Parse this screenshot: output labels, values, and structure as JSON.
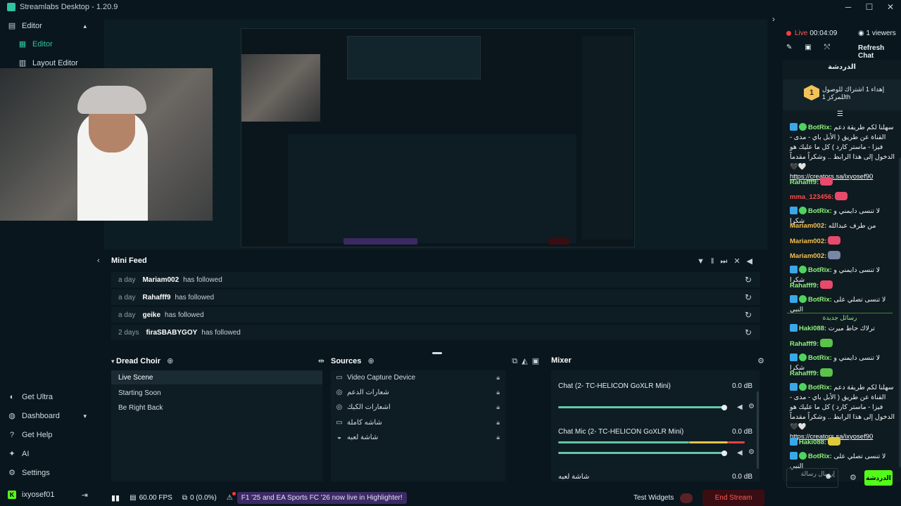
{
  "window": {
    "title": "Streamlabs Desktop - 1.20.9"
  },
  "nav": {
    "editor_group": "Editor",
    "editor": "Editor",
    "layout_editor": "Layout Editor",
    "get_ultra": "Get Ultra",
    "dashboard": "Dashboard",
    "get_help": "Get Help",
    "ai": "AI",
    "settings": "Settings",
    "username": "ixyosef01"
  },
  "mini_feed": {
    "title": "Mini Feed",
    "items": [
      {
        "time": "a day",
        "user": "Mariam002",
        "action": "has followed"
      },
      {
        "time": "a day",
        "user": "Rahafff9",
        "action": "has followed"
      },
      {
        "time": "a day",
        "user": "geike",
        "action": "has followed"
      },
      {
        "time": "2 days",
        "user": "firaSBABYGOY",
        "action": "has followed"
      }
    ]
  },
  "scenes": {
    "title": "Dread Choir",
    "items": [
      "Live Scene",
      "Starting Soon",
      "Be Right Back"
    ],
    "active": "Live Scene"
  },
  "sources": {
    "title": "Sources",
    "items": [
      {
        "icon": "camera-icon",
        "label": "Video Capture Device"
      },
      {
        "icon": "globe-icon",
        "label": "شعارات الدعم"
      },
      {
        "icon": "globe-icon",
        "label": "اشعارات الكبك"
      },
      {
        "icon": "monitor-icon",
        "label": "شاشه كاملة"
      },
      {
        "icon": "gamepad-icon",
        "label": "شاشة لعبه"
      }
    ]
  },
  "mixer": {
    "title": "Mixer",
    "channels": [
      {
        "name": "Chat (2- TC-HELICON GoXLR Mini)",
        "db": "0.0 dB",
        "level": 0.96
      },
      {
        "name": "Chat Mic (2- TC-HELICON GoXLR Mini)",
        "db": "0.0 dB",
        "level": 0.96
      },
      {
        "name": "شاشة لعبه",
        "db": "0.0 dB",
        "level": 0.96
      }
    ]
  },
  "status": {
    "fps": "60.00 FPS",
    "dropped": "0 (0.0%)",
    "notification": "F1 '25 and EA Sports FC '26 now live in Highlighter!",
    "test_widgets": "Test Widgets",
    "end_stream": "End Stream"
  },
  "chat_panel": {
    "live_label": "Live",
    "live_time": "00:04:09",
    "viewers": "1 viewers",
    "refresh": "Refresh Chat",
    "title": "الدردشة",
    "sub_goal_count": "1",
    "sub_goal_text": "إهداء 1 اشتراك للوصول",
    "sub_goal_text2": "للمركز 1th",
    "input_placeholder": "إرسال رسالة",
    "send_label": "الدردشة",
    "new_messages_divider": "رسائل جديدة",
    "messages": [
      {
        "user": "BotRix",
        "color": "green",
        "badges": [
          "blue",
          "green"
        ],
        "text": "سهلنا لكم طريقة دعم القناة عن طريق ( الأبل باي - مدى - فيزا - ماستر كارد ) كل ما عليك هو الدخول إلى هذا الرابط .. وشكراً مقدماً 🖤🤍",
        "link": "https://creators.sa/ixyosef90"
      },
      {
        "user": "Rahafff9",
        "color": "green",
        "badges": [],
        "text": "",
        "emote": "#e84a6b"
      },
      {
        "user": "mma_123456",
        "color": "red",
        "badges": [],
        "text": "",
        "emote": "#e84a6b"
      },
      {
        "user": "BotRix",
        "color": "green",
        "badges": [
          "blue",
          "green"
        ],
        "text": "لا تنسى دايمني و شكرا"
      },
      {
        "user": "Mariam002",
        "color": "yellow",
        "badges": [],
        "text": "من طرف عبدالله"
      },
      {
        "user": "Mariam002",
        "color": "yellow",
        "badges": [],
        "text": "",
        "emote": "#e84a6b"
      },
      {
        "user": "Mariam002",
        "color": "yellow",
        "badges": [],
        "text": "",
        "emote": "#7a86a6"
      },
      {
        "user": "BotRix",
        "color": "green",
        "badges": [
          "blue",
          "green"
        ],
        "text": "لا تنسى دايمني و شكرا"
      },
      {
        "user": "Rahafff9",
        "color": "green",
        "badges": [],
        "text": "",
        "emote": "#e84a6b"
      },
      {
        "user": "BotRix",
        "color": "green",
        "badges": [
          "blue",
          "green"
        ],
        "text": "لا تنسى تصلي على النبي"
      },
      {
        "user": "Haki088",
        "color": "green",
        "badges": [
          "blue"
        ],
        "text": "ترلاك حاط ميرت"
      },
      {
        "user": "Rahafff9",
        "color": "green",
        "badges": [],
        "text": "",
        "emote": "#5bc24a"
      },
      {
        "user": "BotRix",
        "color": "green",
        "badges": [
          "blue",
          "green"
        ],
        "text": "لا تنسى دايمني و شكرا"
      },
      {
        "user": "Rahafff9",
        "color": "green",
        "badges": [],
        "text": "",
        "emote": "#5bc24a"
      },
      {
        "user": "BotRix",
        "color": "green",
        "badges": [
          "blue",
          "green"
        ],
        "text": "سهلنا لكم طريقة دعم القناة عن طريق ( الأبل باي - مدى - فيزا - ماستر كارد ) كل ما عليك هو الدخول إلى هذا الرابط .. وشكراً مقدماً 🖤🤍",
        "link": "https://creators.sa/ixyosef90"
      },
      {
        "user": "Haki088",
        "color": "green",
        "badges": [
          "blue"
        ],
        "text": "",
        "emote": "#e0c93a"
      },
      {
        "user": "BotRix",
        "color": "green",
        "badges": [
          "blue",
          "green"
        ],
        "text": "لا تنسى تصلي على النبي"
      }
    ]
  },
  "colors": {
    "bg": "#09161d",
    "panel": "#0e1d24",
    "accent": "#31c3a2",
    "live_red": "#ff3b3b",
    "end_stream_bg": "#3a0d12",
    "end_stream_text": "#ff5a5a",
    "chat_send_green": "#53fc18"
  }
}
